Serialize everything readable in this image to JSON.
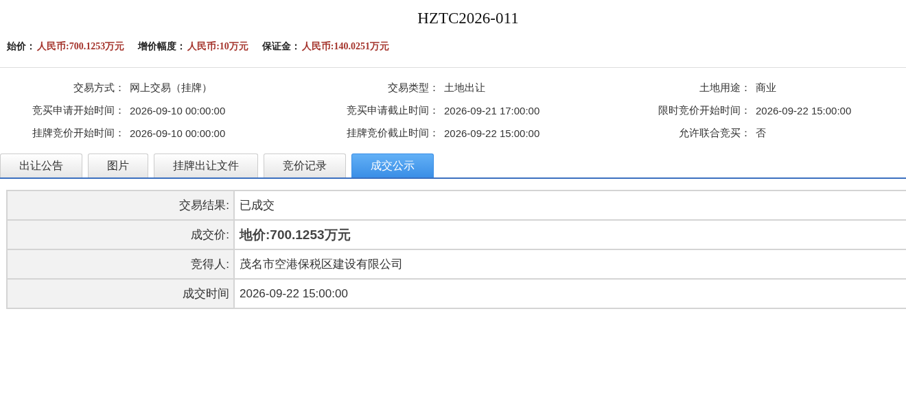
{
  "title": "HZTC2026-011",
  "price_summary": [
    {
      "label": "始价：",
      "value": "人民币:700.1253万元"
    },
    {
      "label": "增价幅度：",
      "value": "人民币:10万元"
    },
    {
      "label": "保证金：",
      "value": "人民币:140.0251万元"
    }
  ],
  "info_fields": [
    {
      "label": "交易方式：",
      "value": "网上交易（挂牌）"
    },
    {
      "label": "交易类型：",
      "value": "土地出让"
    },
    {
      "label": "土地用途：",
      "value": "商业"
    },
    {
      "label": "竞买申请开始时间：",
      "value": "2026-09-10 00:00:00"
    },
    {
      "label": "竞买申请截止时间：",
      "value": "2026-09-21 17:00:00"
    },
    {
      "label": "限时竞价开始时间：",
      "value": "2026-09-22 15:00:00"
    },
    {
      "label": "挂牌竞价开始时间：",
      "value": "2026-09-10 00:00:00"
    },
    {
      "label": "挂牌竞价截止时间：",
      "value": "2026-09-22 15:00:00"
    },
    {
      "label": "允许联合竞买：",
      "value": "否"
    }
  ],
  "tabs": [
    {
      "label": "出让公告",
      "selected": false
    },
    {
      "label": "图片",
      "selected": false
    },
    {
      "label": "挂牌出让文件",
      "selected": false
    },
    {
      "label": "竞价记录",
      "selected": false
    },
    {
      "label": "成交公示",
      "selected": true
    }
  ],
  "result_table": {
    "rows": [
      {
        "label": "交易结果:",
        "value": "已成交",
        "kind": "plain"
      },
      {
        "label": "成交价:",
        "value": "地价:700.1253万元",
        "kind": "emphasis"
      },
      {
        "label": "竞得人:",
        "value": "茂名市空港保税区建设有限公司",
        "kind": "plain"
      },
      {
        "label": "成交时间",
        "value": "2026-09-22 15:00:00",
        "kind": "plain"
      }
    ]
  }
}
